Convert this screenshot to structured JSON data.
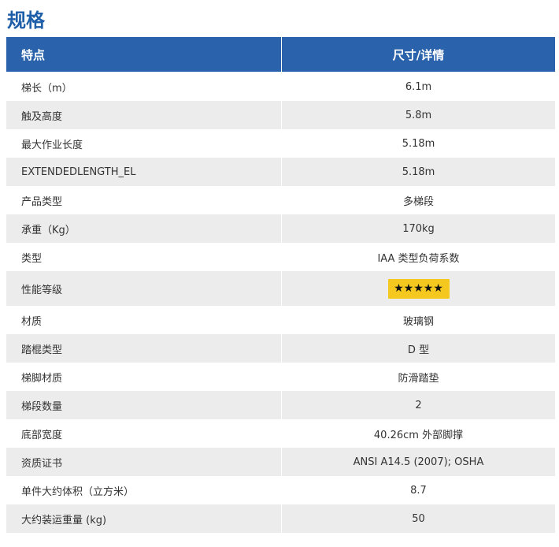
{
  "page": {
    "title": "规格"
  },
  "table": {
    "headers": {
      "feature": "特点",
      "details": "尺寸/详情"
    },
    "rows": [
      {
        "feature": "梯长（m）",
        "value": "6.1m"
      },
      {
        "feature": "触及高度",
        "value": "5.8m"
      },
      {
        "feature": "最大作业长度",
        "value": "5.18m"
      },
      {
        "feature": "EXTENDEDLENGTH_EL",
        "value": "5.18m"
      },
      {
        "feature": "产品类型",
        "value": "多梯段"
      },
      {
        "feature": "承重（Kg）",
        "value": "170kg"
      },
      {
        "feature": "类型",
        "value": "IAA 类型负荷系数"
      },
      {
        "feature": "性能等级",
        "value": "★★★★★",
        "rating": 5
      },
      {
        "feature": "材质",
        "value": "玻璃钢"
      },
      {
        "feature": "踏棍类型",
        "value": "D 型"
      },
      {
        "feature": "梯脚材质",
        "value": "防滑踏垫"
      },
      {
        "feature": "梯段数量",
        "value": "2"
      },
      {
        "feature": "底部宽度",
        "value": "40.26cm 外部脚撑"
      },
      {
        "feature": "资质证书",
        "value": "ANSI A14.5 (2007); OSHA"
      },
      {
        "feature": "单件大约体积（立方米）",
        "value": "8.7"
      },
      {
        "feature": "大约装运重量 (kg)",
        "value": "50"
      }
    ]
  },
  "colors": {
    "title": "#1f5ea8",
    "header_background": "#2a62ac",
    "header_text": "#ffffff",
    "alternate_row_background": "#ececec",
    "rating_badge_background": "#f4c81f"
  }
}
